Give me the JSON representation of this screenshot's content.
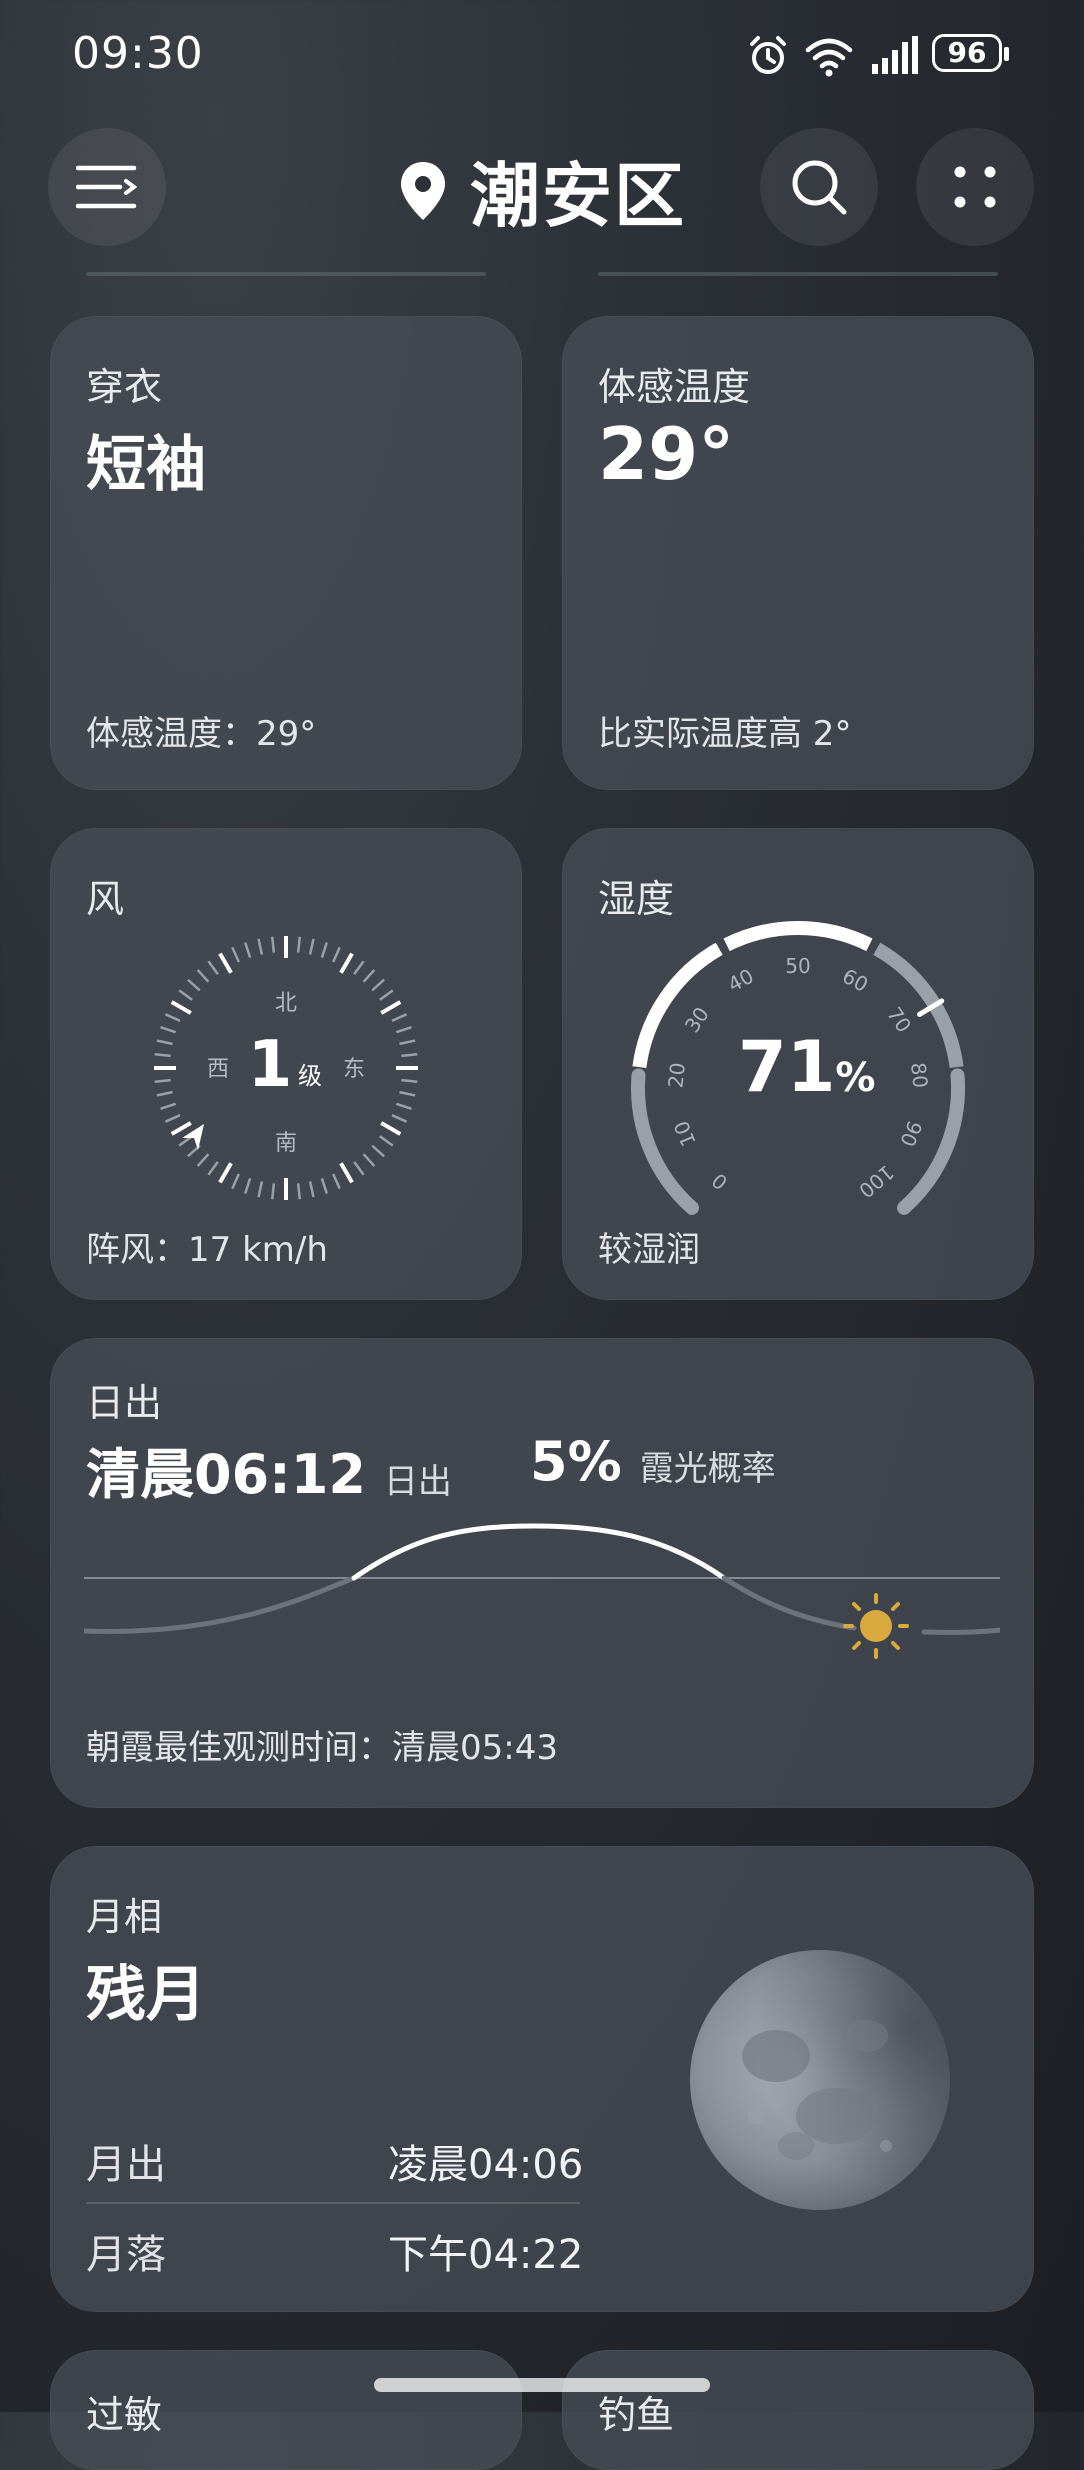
{
  "status_bar": {
    "time": "09:30",
    "battery": "96"
  },
  "header": {
    "city": "潮安区"
  },
  "clothing": {
    "title": "穿衣",
    "value": "短袖",
    "footer": "体感温度：29°"
  },
  "feels_like": {
    "title": "体感温度",
    "value": "29°",
    "footer": "比实际温度高 2°"
  },
  "wind": {
    "title": "风",
    "level": "1",
    "level_unit": "级",
    "north": "北",
    "south": "南",
    "east": "东",
    "west": "西",
    "gust": "阵风：17 km/h"
  },
  "humidity": {
    "title": "湿度",
    "value": "71",
    "unit": "%",
    "desc": "较湿润",
    "percent": 71,
    "ticks": [
      "0",
      "10",
      "20",
      "30",
      "40",
      "50",
      "60",
      "70",
      "80",
      "90",
      "100"
    ]
  },
  "sunrise": {
    "title": "日出",
    "time": "清晨06:12",
    "time_label": "日出",
    "glow_percent": "5%",
    "glow_label": "霞光概率",
    "footer": "朝霞最佳观测时间：清晨05:43"
  },
  "moon": {
    "title": "月相",
    "phase": "残月",
    "rise_label": "月出",
    "rise_time": "凌晨04:06",
    "set_label": "月落",
    "set_time": "下午04:22"
  },
  "partial_cards": {
    "left_title": "过敏",
    "right_title": "钓鱼"
  },
  "colors": {
    "card_bg": "#484d56",
    "sun": "#d8a93c",
    "accent_text": "#ffffff"
  },
  "icons": [
    "menu-icon",
    "location-pin-icon",
    "search-icon",
    "more-dots-icon",
    "alarm-icon",
    "wifi-icon",
    "signal-icon",
    "battery-icon",
    "sun-icon",
    "moon-image"
  ]
}
